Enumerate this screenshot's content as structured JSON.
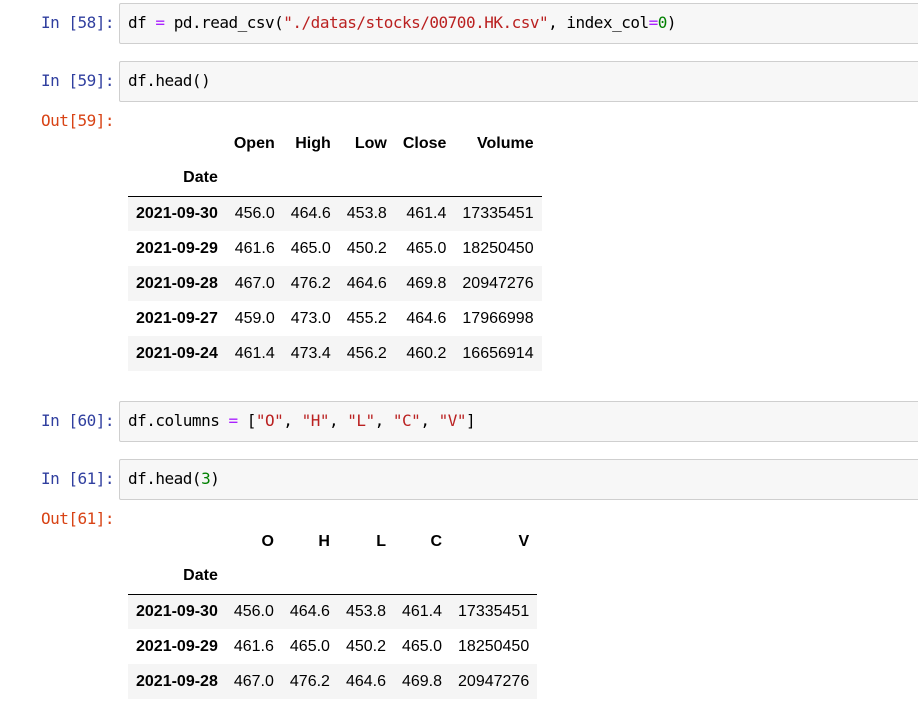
{
  "cells": {
    "c58": {
      "prompt": "In  [58]:",
      "code": {
        "t1": "df",
        "t2": "=",
        "t3": "pd.read_csv(",
        "t4": "\"./datas/stocks/00700.HK.csv\"",
        "t5": ", index_col",
        "t6": "=",
        "t7": "0",
        "t8": ")"
      }
    },
    "c59": {
      "prompt": "In  [59]:",
      "code": {
        "t1": "df.head()"
      },
      "out_prompt": "Out[59]:",
      "table": {
        "columns": [
          "Open",
          "High",
          "Low",
          "Close",
          "Volume"
        ],
        "index_name": "Date",
        "rows": [
          {
            "date": "2021-09-30",
            "vals": [
              "456.0",
              "464.6",
              "453.8",
              "461.4",
              "17335451"
            ]
          },
          {
            "date": "2021-09-29",
            "vals": [
              "461.6",
              "465.0",
              "450.2",
              "465.0",
              "18250450"
            ]
          },
          {
            "date": "2021-09-28",
            "vals": [
              "467.0",
              "476.2",
              "464.6",
              "469.8",
              "20947276"
            ]
          },
          {
            "date": "2021-09-27",
            "vals": [
              "459.0",
              "473.0",
              "455.2",
              "464.6",
              "17966998"
            ]
          },
          {
            "date": "2021-09-24",
            "vals": [
              "461.4",
              "473.4",
              "456.2",
              "460.2",
              "16656914"
            ]
          }
        ]
      }
    },
    "c60": {
      "prompt": "In  [60]:",
      "code": {
        "t1": "df.columns",
        "t2": "=",
        "t3": "[",
        "t4": "\"O\"",
        "t5": ", ",
        "t6": "\"H\"",
        "t7": ", ",
        "t8": "\"L\"",
        "t9": ", ",
        "t10": "\"C\"",
        "t11": ", ",
        "t12": "\"V\"",
        "t13": "]"
      }
    },
    "c61": {
      "prompt": "In  [61]:",
      "code": {
        "t1": "df.head(",
        "t2": "3",
        "t3": ")"
      },
      "out_prompt": "Out[61]:",
      "table": {
        "columns": [
          "O",
          "H",
          "L",
          "C",
          "V"
        ],
        "index_name": "Date",
        "rows": [
          {
            "date": "2021-09-30",
            "vals": [
              "456.0",
              "464.6",
              "453.8",
              "461.4",
              "17335451"
            ]
          },
          {
            "date": "2021-09-29",
            "vals": [
              "461.6",
              "465.0",
              "450.2",
              "465.0",
              "18250450"
            ]
          },
          {
            "date": "2021-09-28",
            "vals": [
              "467.0",
              "476.2",
              "464.6",
              "469.8",
              "20947276"
            ]
          }
        ]
      }
    }
  }
}
